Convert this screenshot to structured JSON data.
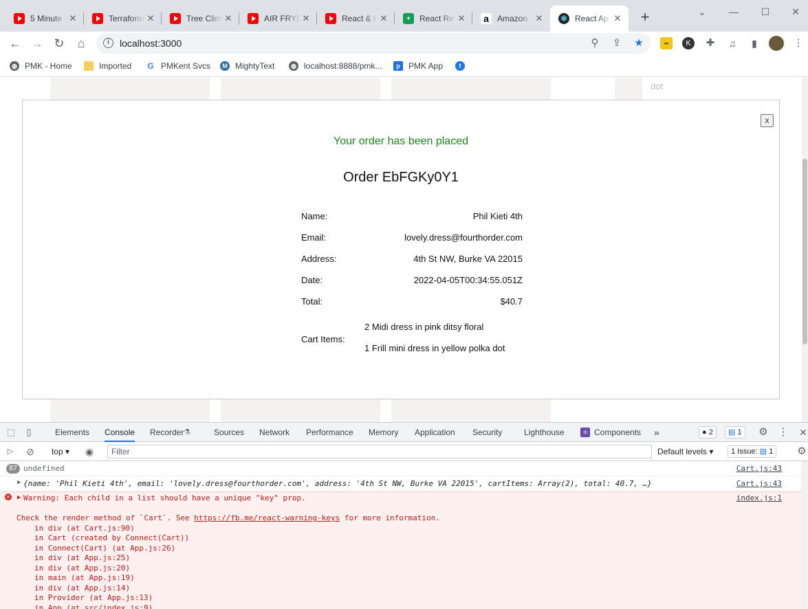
{
  "browser": {
    "tabs": [
      {
        "title": "5 Minute",
        "icon": "youtube-icon"
      },
      {
        "title": "Terraform",
        "icon": "youtube-icon"
      },
      {
        "title": "Tree Clim",
        "icon": "youtube-icon"
      },
      {
        "title": "AIR FRYE",
        "icon": "youtube-icon"
      },
      {
        "title": "React & I",
        "icon": "youtube-icon"
      },
      {
        "title": "React Re",
        "icon": "sheets-icon"
      },
      {
        "title": "Amazon",
        "icon": "amazon-icon"
      },
      {
        "title": "React Ap",
        "icon": "react-icon",
        "active": true
      }
    ],
    "new_tab": "+",
    "url": "localhost:3000",
    "bookmarks": [
      {
        "label": "PMK - Home"
      },
      {
        "label": "Imported"
      },
      {
        "label": "PMKent Svcs"
      },
      {
        "label": "MightyText"
      },
      {
        "label": "localhost:8888/pmk..."
      },
      {
        "label": "PMK App"
      }
    ]
  },
  "page": {
    "side_text": "dot",
    "modal": {
      "close_label": "x",
      "success_message": "Your order has been placed",
      "order_title": "Order EbFGKy0Y1",
      "fields": [
        {
          "label": "Name:",
          "value": "Phil Kieti 4th"
        },
        {
          "label": "Email:",
          "value": "lovely.dress@fourthorder.com"
        },
        {
          "label": "Address:",
          "value": "4th St NW, Burke VA 22015"
        },
        {
          "label": "Date:",
          "value": "2022-04-05T00:34:55.051Z"
        },
        {
          "label": "Total:",
          "value": "$40.7"
        }
      ],
      "cart_label": "Cart Items:",
      "cart_items": [
        "2 Midi dress in pink ditsy floral",
        "1 Frill mini dress in yellow polka dot"
      ]
    }
  },
  "devtools": {
    "tabs": [
      "Elements",
      "Console",
      "Recorder",
      "Sources",
      "Network",
      "Performance",
      "Memory",
      "Application",
      "Security",
      "Lighthouse",
      "Components"
    ],
    "active_tab": "Console",
    "more": "»",
    "error_count": "2",
    "message_count": "1",
    "context": "top",
    "filter_placeholder": "Filter",
    "levels": "Default levels",
    "issues": "1 Issue:",
    "issues_count": "1",
    "console": {
      "line1": {
        "count": "87",
        "text": "undefined",
        "source": "Cart.js:43"
      },
      "line2": {
        "text": "{name: 'Phil Kieti 4th', email: 'lovely.dress@fourthorder.com', address: '4th St NW, Burke VA 22015', cartItems: Array(2), total: 40.7, …}",
        "source": "Cart.js:43"
      },
      "warning": {
        "text": "Warning: Each child in a list should have a unique \"key\" prop.",
        "source": "index.js:1"
      },
      "check_pre": "Check the render method of `Cart`. See ",
      "check_link": "https://fb.me/react-warning-keys",
      "check_post": " for more information.",
      "stack": [
        "in div (at Cart.js:90)",
        "in Cart (created by Connect(Cart))",
        "in Connect(Cart) (at App.js:26)",
        "in div (at App.js:25)",
        "in div (at App.js:20)",
        "in main (at App.js:19)",
        "in div (at App.js:14)",
        "in Provider (at App.js:13)",
        "in App (at src/index.js:9)"
      ]
    }
  }
}
